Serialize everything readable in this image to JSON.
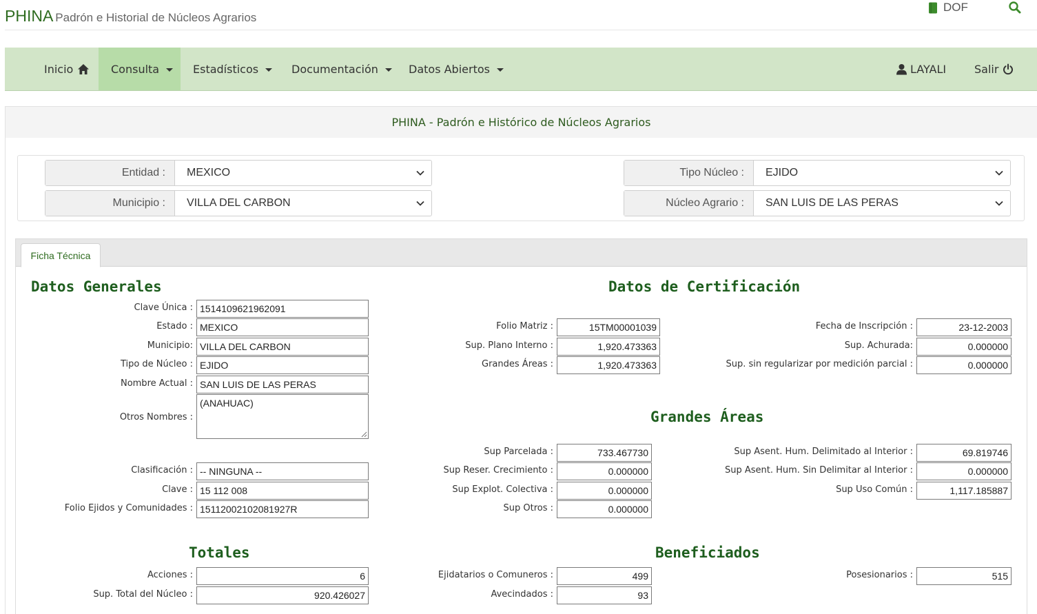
{
  "header": {
    "brand": "PHINA",
    "subtitle": "Padrón e Historial de Núcleos Agrarios",
    "dof_label": "DOF",
    "dof_icon": "book-icon",
    "search_icon": "search-icon"
  },
  "nav": {
    "inicio": "Inicio",
    "consulta": "Consulta",
    "estadisticos": "Estadísticos",
    "documentacion": "Documentación",
    "datos_abiertos": "Datos Abiertos",
    "user": "LAYALI",
    "salir": "Salir"
  },
  "panel": {
    "title": "PHINA - Padrón e Histórico de Núcleos Agrarios"
  },
  "filters": {
    "entidad_label": "Entidad :",
    "entidad_value": "MEXICO",
    "municipio_label": "Municipio :",
    "municipio_value": "VILLA DEL CARBON",
    "tipo_label": "Tipo Núcleo :",
    "tipo_value": "EJIDO",
    "nucleo_label": "Núcleo Agrario :",
    "nucleo_value": "SAN LUIS DE LAS PERAS"
  },
  "tabs": {
    "ficha": "Ficha Técnica"
  },
  "generales": {
    "title": "Datos Generales",
    "clave_unica_label": "Clave Única :",
    "clave_unica": "1514109621962091",
    "estado_label": "Estado :",
    "estado": "MEXICO",
    "municipio_label": "Municipio:",
    "municipio": "VILLA DEL CARBON",
    "tipo_label": "Tipo de Núcleo :",
    "tipo": "EJIDO",
    "nombre_label": "Nombre Actual :",
    "nombre": "SAN LUIS DE LAS PERAS",
    "otros_label": "Otros Nombres :",
    "otros": "(ANAHUAC)",
    "clasificacion_label": "Clasificación :",
    "clasificacion": "-- NINGUNA --",
    "clave_label": "Clave :",
    "clave": "15 112 008",
    "folio_label": "Folio Ejidos y Comunidades :",
    "folio": "15112002102081927R"
  },
  "certificacion": {
    "title": "Datos de Certificación",
    "folio_matriz_label": "Folio Matriz :",
    "folio_matriz": "15TM00001039",
    "sup_plano_label": "Sup. Plano Interno :",
    "sup_plano": "1,920.473363",
    "grandes_label": "Grandes Áreas :",
    "grandes": "1,920.473363",
    "fecha_label": "Fecha de Inscripción :",
    "fecha": "23-12-2003",
    "achurada_label": "Sup. Achurada:",
    "achurada": "0.000000",
    "sin_reg_label": "Sup. sin regularizar por medición parcial :",
    "sin_reg": "0.000000"
  },
  "grandes_areas": {
    "title": "Grandes Áreas",
    "parcelada_label": "Sup Parcelada :",
    "parcelada": "733.467730",
    "reser_label": "Sup Reser. Crecimiento :",
    "reser": "0.000000",
    "explot_label": "Sup Explot. Colectiva :",
    "explot": "0.000000",
    "otros_label": "Sup Otros :",
    "otros": "0.000000",
    "asent_del_label": "Sup Asent. Hum. Delimitado al Interior :",
    "asent_del": "69.819746",
    "asent_sin_label": "Sup Asent. Hum. Sin Delimitar al Interior :",
    "asent_sin": "0.000000",
    "uso_comun_label": "Sup Uso Común :",
    "uso_comun": "1,117.185887"
  },
  "totales": {
    "title": "Totales",
    "acciones_label": "Acciones :",
    "acciones": "6",
    "sup_total_label": "Sup. Total del Núcleo :",
    "sup_total": "920.426027"
  },
  "beneficiados": {
    "title": "Beneficiados",
    "ejidatarios_label": "Ejidatarios o Comuneros :",
    "ejidatarios": "499",
    "avecindados_label": "Avecindados :",
    "avecindados": "93",
    "posesionarios_label": "Posesionarios :",
    "posesionarios": "515"
  }
}
